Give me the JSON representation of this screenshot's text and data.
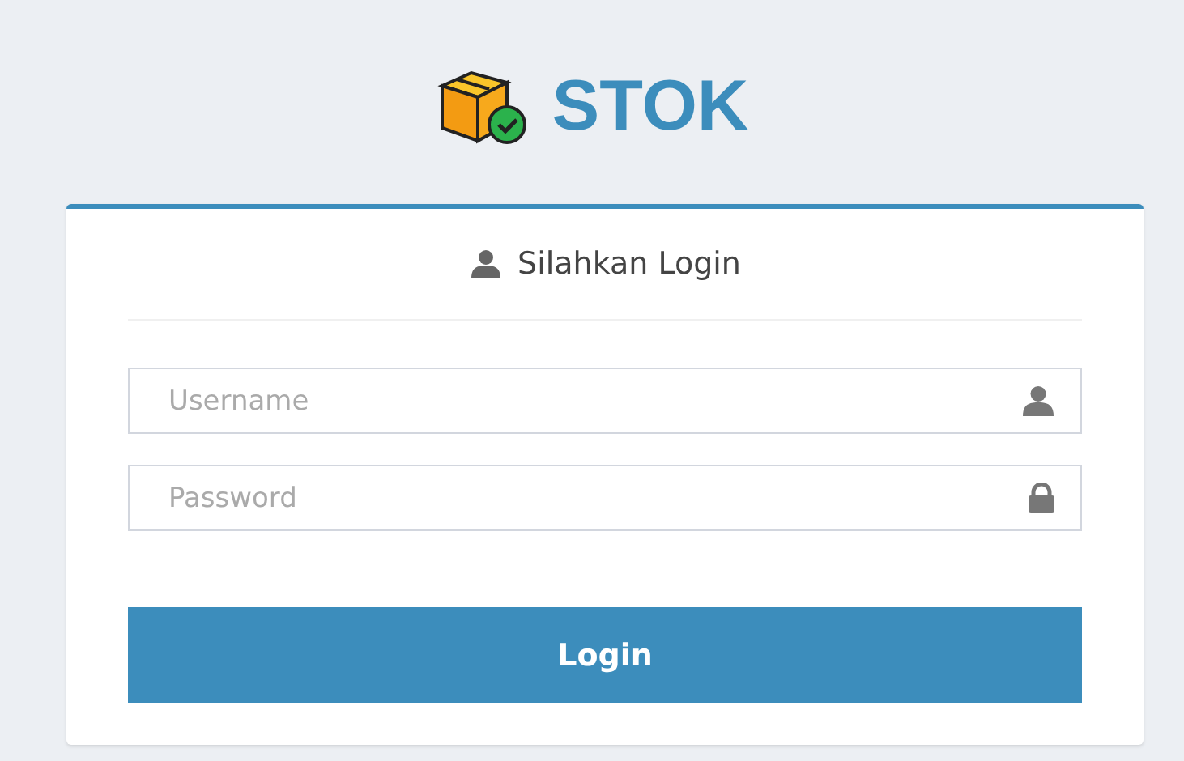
{
  "logo": {
    "text": "STOK"
  },
  "panel": {
    "title": "Silahkan Login"
  },
  "fields": [
    {
      "kind": "user",
      "placeholder": "Username"
    },
    {
      "kind": "lock",
      "placeholder": "Password"
    }
  ],
  "button": {
    "label": "Login"
  }
}
